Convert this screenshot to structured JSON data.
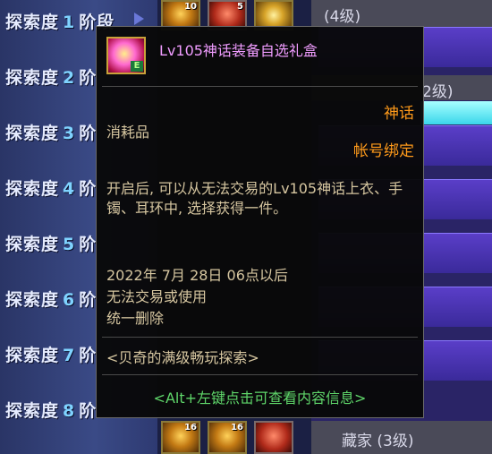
{
  "stages": [
    {
      "label": "探索度",
      "num": "1",
      "suffix": "阶段"
    },
    {
      "label": "探索度",
      "num": "2",
      "suffix": "阶"
    },
    {
      "label": "探索度",
      "num": "3",
      "suffix": "阶"
    },
    {
      "label": "探索度",
      "num": "4",
      "suffix": "阶"
    },
    {
      "label": "探索度",
      "num": "5",
      "suffix": "阶"
    },
    {
      "label": "探索度",
      "num": "6",
      "suffix": "阶"
    },
    {
      "label": "探索度",
      "num": "7",
      "suffix": "阶"
    },
    {
      "label": "探索度",
      "num": "8",
      "suffix": "阶"
    }
  ],
  "slots_top": [
    "10",
    "5",
    ""
  ],
  "slots_bottom": [
    "16",
    "16",
    ""
  ],
  "right_column": {
    "row1": "(4级)",
    "row2": "2级)",
    "row_last": "藏家 (3级)"
  },
  "tooltip": {
    "title": "Lv105神话装备自选礼盒",
    "grade": "神话",
    "category": "消耗品",
    "bind": "帐号绑定",
    "description": "开启后, 可以从无法交易的Lv105神话上衣、手镯、耳环中, 选择获得一件。",
    "date": "2022年 7月 28日 06点以后",
    "restriction1": "无法交易或使用",
    "restriction2": "统一删除",
    "source": "<贝奇的满级畅玩探索>",
    "hint": "<Alt+左键点击可查看内容信息>",
    "icon_badge": "E"
  },
  "colors": {
    "title": "#f09cff",
    "orange": "#ff9a1a",
    "tan": "#d6c6a0",
    "green": "#5fd66a"
  }
}
